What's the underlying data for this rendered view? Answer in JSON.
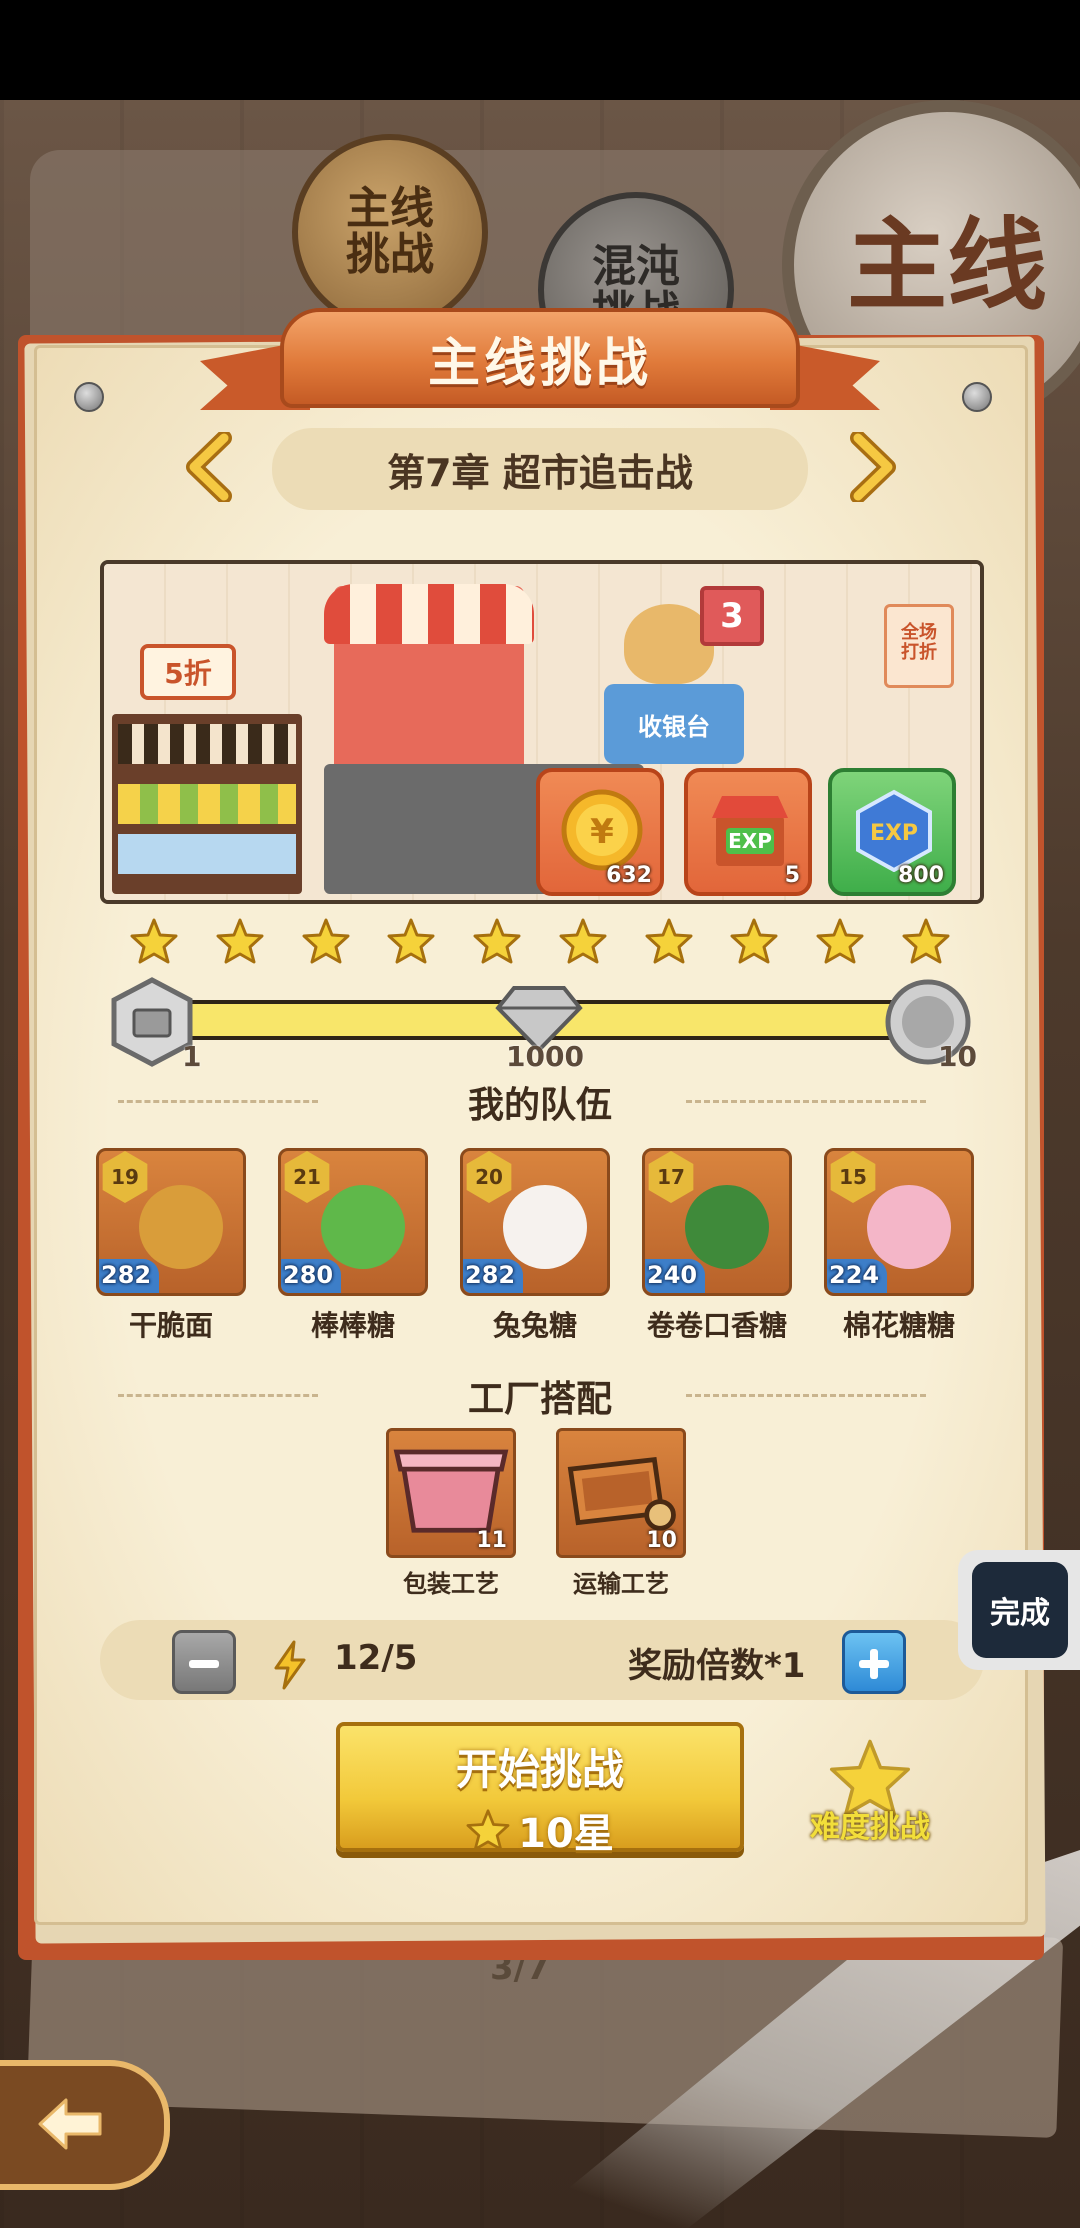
{
  "tabs": {
    "main_line": "主线\n挑战",
    "chaos": "混沌\n挑战",
    "big_badge": "主线"
  },
  "panel": {
    "title": "主线挑战",
    "chapter": "第7章  超市追击战",
    "prev_icon": "chevron-left-icon",
    "next_icon": "chevron-right-icon"
  },
  "stage_scene": {
    "sale_sign": "5折",
    "register_sign": "收银台",
    "number_sign": "3",
    "discount_sign": "全场\n打折"
  },
  "rewards": [
    {
      "icon": "coin-icon",
      "quantity": "632"
    },
    {
      "icon": "shop-exp-icon",
      "quantity": "5"
    },
    {
      "icon": "exp-badge-icon",
      "quantity": "800"
    }
  ],
  "stars": {
    "earned": 10,
    "total": 10
  },
  "progress": {
    "fill_fraction": 1.0,
    "milestones": [
      {
        "icon": "silver-chest-icon",
        "label": "1"
      },
      {
        "icon": "diamond-icon",
        "label": "1000"
      },
      {
        "icon": "silver-coin-icon",
        "label": "10"
      }
    ]
  },
  "team": {
    "title": "我的队伍",
    "heroes": [
      {
        "name": "干脆面",
        "level": "19",
        "power": "282",
        "color": "#d99d3a"
      },
      {
        "name": "棒棒糖",
        "level": "21",
        "power": "280",
        "color": "#5fb84a"
      },
      {
        "name": "兔兔糖",
        "level": "20",
        "power": "282",
        "color": "#f6f2ee"
      },
      {
        "name": "卷卷口香糖",
        "level": "17",
        "power": "240",
        "color": "#3f8a3a"
      },
      {
        "name": "棉花糖糖",
        "level": "15",
        "power": "224",
        "color": "#f4b6c8"
      }
    ]
  },
  "factory": {
    "title": "工厂搭配",
    "items": [
      {
        "name": "包装工艺",
        "level": "11",
        "icon": "pink-box-icon"
      },
      {
        "name": "运输工艺",
        "level": "10",
        "icon": "wooden-cart-icon"
      }
    ]
  },
  "controls": {
    "energy": "12/5",
    "multiplier": "奖励倍数*1"
  },
  "start": {
    "title": "开始挑战",
    "cost": "10星"
  },
  "difficulty": {
    "label": "难度挑战"
  },
  "done_button": {
    "label": "完成"
  },
  "bottom_page": {
    "indicator": "3/7"
  },
  "colors": {
    "ribbon": "#e07a3a",
    "paper": "#f8efd6",
    "start_button": "#f2c93a",
    "plus_button": "#2e8ad6"
  }
}
